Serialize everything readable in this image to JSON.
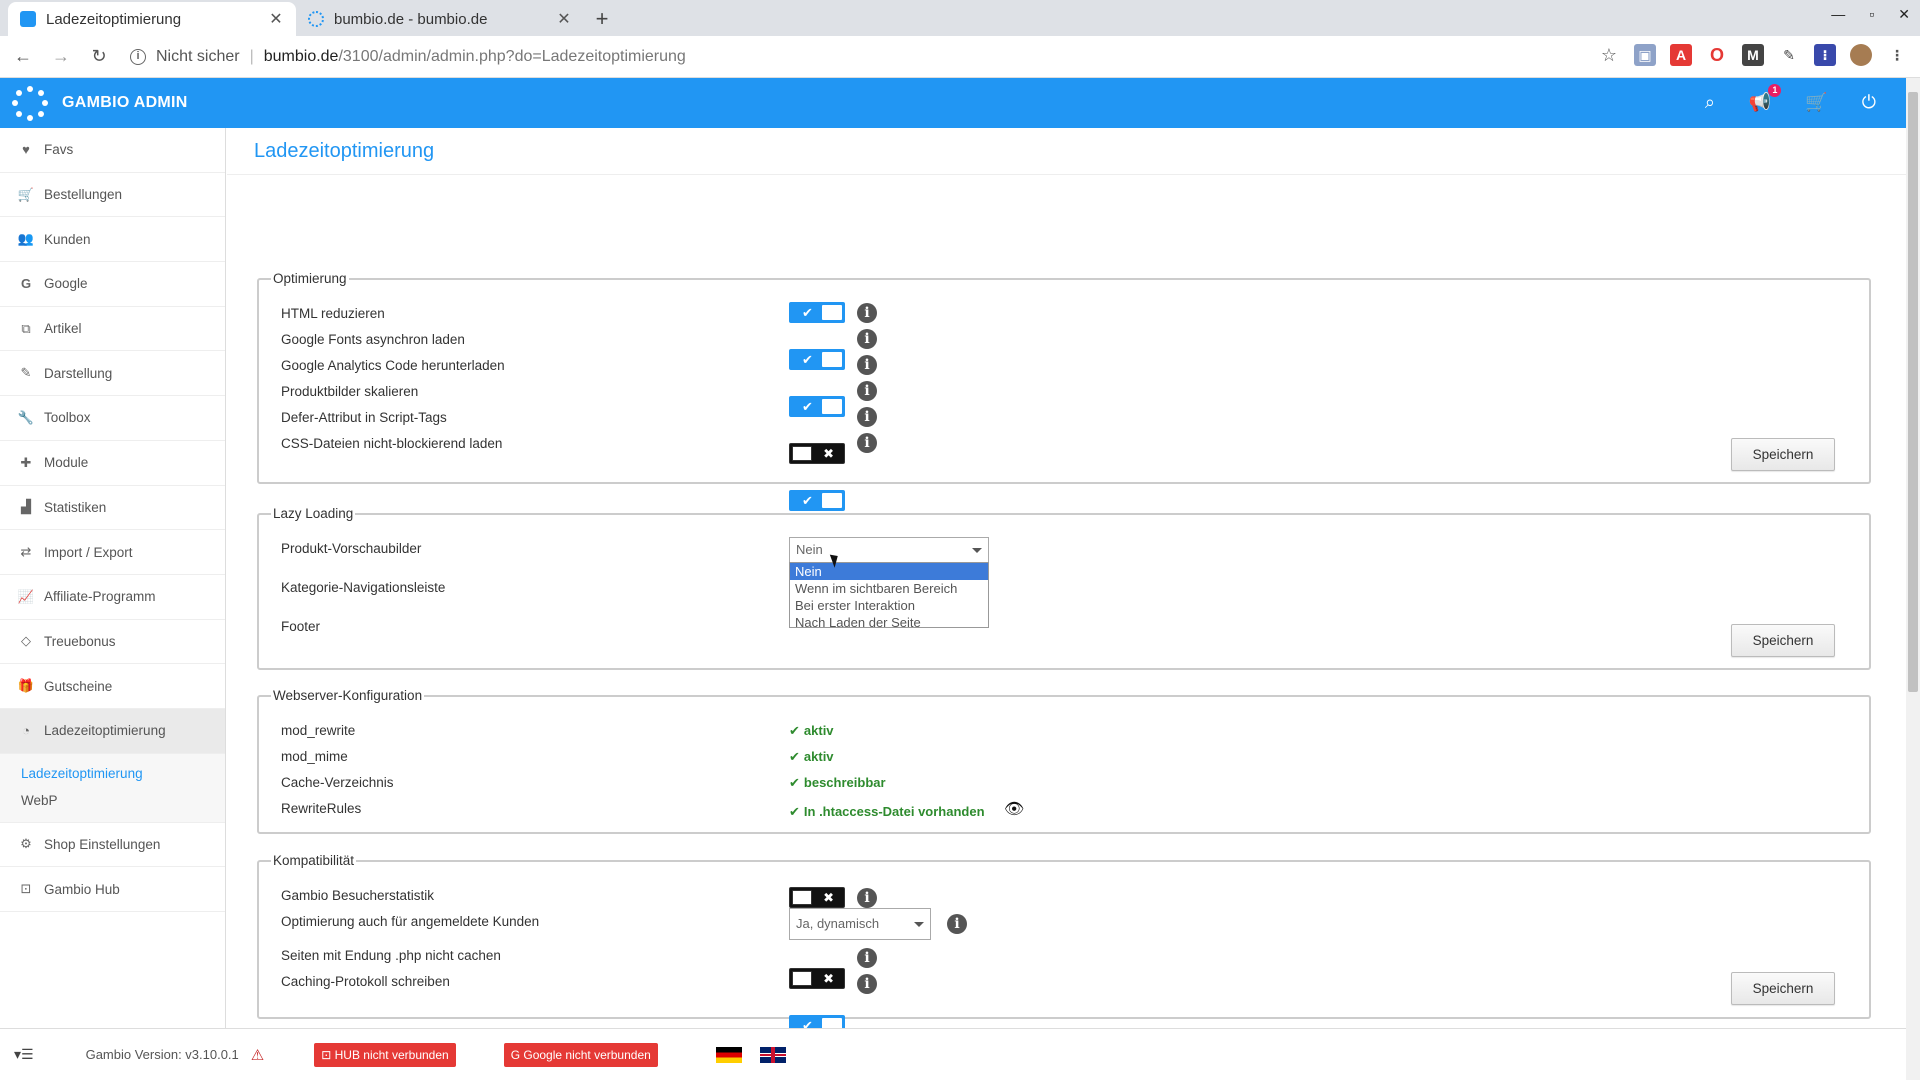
{
  "browser": {
    "tabs": [
      {
        "title": "Ladezeitoptimierung",
        "active": true
      },
      {
        "title": "bumbio.de - bumbio.de",
        "active": false
      }
    ],
    "insecure_label": "Nicht sicher",
    "url_host": "bumbio.de",
    "url_path": "/3100/admin/admin.php?do=Ladezeitoptimierung"
  },
  "header": {
    "brand": "GAMBIO ADMIN",
    "notification_count": "1",
    "accent": "#2196f3"
  },
  "sidebar": {
    "items": [
      {
        "label": "Favs",
        "icon": "heart-icon"
      },
      {
        "label": "Bestellungen",
        "icon": "cart-icon"
      },
      {
        "label": "Kunden",
        "icon": "users-icon"
      },
      {
        "label": "Google",
        "icon": "google-icon"
      },
      {
        "label": "Artikel",
        "icon": "sitemap-icon"
      },
      {
        "label": "Darstellung",
        "icon": "brush-icon"
      },
      {
        "label": "Toolbox",
        "icon": "wrench-icon"
      },
      {
        "label": "Module",
        "icon": "puzzle-icon"
      },
      {
        "label": "Statistiken",
        "icon": "chart-icon"
      },
      {
        "label": "Import / Export",
        "icon": "exchange-icon"
      },
      {
        "label": "Affiliate-Programm",
        "icon": "line-chart-icon"
      },
      {
        "label": "Treuebonus",
        "icon": "diamond-icon"
      },
      {
        "label": "Gutscheine",
        "icon": "gift-icon"
      },
      {
        "label": "Ladezeitoptimierung",
        "icon": "dashboard-icon"
      }
    ],
    "sub_items": [
      "Ladezeitoptimierung",
      "WebP"
    ],
    "bottom_items": [
      {
        "label": "Shop Einstellungen",
        "icon": "cogs-icon"
      },
      {
        "label": "Gambio Hub",
        "icon": "hub-icon"
      }
    ]
  },
  "page": {
    "title": "Ladezeitoptimierung",
    "save_label": "Speichern",
    "optimierung": {
      "legend": "Optimierung",
      "rows": [
        {
          "label": "HTML reduzieren",
          "on": true
        },
        {
          "label": "Google Fonts asynchron laden",
          "on": true
        },
        {
          "label": "Google Analytics Code herunterladen",
          "on": true
        },
        {
          "label": "Produktbilder skalieren",
          "on": false
        },
        {
          "label": "Defer-Attribut in Script-Tags",
          "on": true
        },
        {
          "label": "CSS-Dateien nicht-blockierend laden",
          "on": false
        }
      ]
    },
    "lazy": {
      "legend": "Lazy Loading",
      "rows": [
        "Produkt-Vorschaubilder",
        "Kategorie-Navigationsleiste",
        "Footer"
      ],
      "select_value": "Nein",
      "options": [
        "Nein",
        "Wenn im sichtbaren Bereich",
        "Bei erster Interaktion",
        "Nach Laden der Seite"
      ]
    },
    "webserver": {
      "legend": "Webserver-Konfiguration",
      "rows": [
        {
          "label": "mod_rewrite",
          "status": "aktiv"
        },
        {
          "label": "mod_mime",
          "status": "aktiv"
        },
        {
          "label": "Cache-Verzeichnis",
          "status": "beschreibbar"
        },
        {
          "label": "RewriteRules",
          "status": "In .htaccess-Datei vorhanden"
        }
      ]
    },
    "kompat": {
      "legend": "Kompatibilität",
      "rows": [
        {
          "label": "Gambio Besucherstatistik",
          "on": false
        },
        {
          "label": "Optimierung auch für angemeldete Kunden"
        },
        {
          "label": "Seiten mit Endung .php nicht cachen",
          "on": false
        },
        {
          "label": "Caching-Protokoll schreiben",
          "on": true
        }
      ],
      "select_value": "Ja, dynamisch"
    }
  },
  "footer": {
    "version": "Gambio Version: v3.10.0.1",
    "hub_status": "HUB nicht verbunden",
    "google_status": "Google nicht verbunden"
  }
}
